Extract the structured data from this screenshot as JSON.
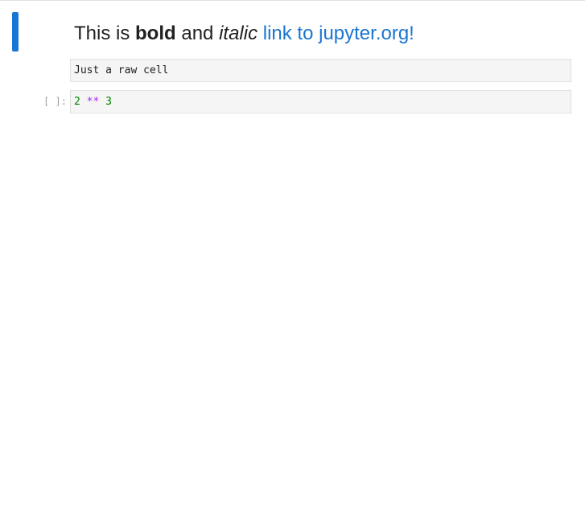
{
  "notebook": {
    "markdown_cell": {
      "text_prefix": "This is ",
      "text_bold": "bold",
      "text_middle": " and ",
      "text_italic": "italic",
      "link_text": "link to jupyter.org!"
    },
    "raw_cell": {
      "source": "Just a raw cell"
    },
    "code_cell": {
      "prompt": "[ ]:",
      "tokens": {
        "num1": "2",
        "op": "**",
        "num2": "3"
      }
    }
  },
  "colors": {
    "accent": "#1976d2",
    "number": "#008000",
    "operator": "#aa22ff"
  },
  "icons": {
    "collapser": "collapser-bar"
  }
}
